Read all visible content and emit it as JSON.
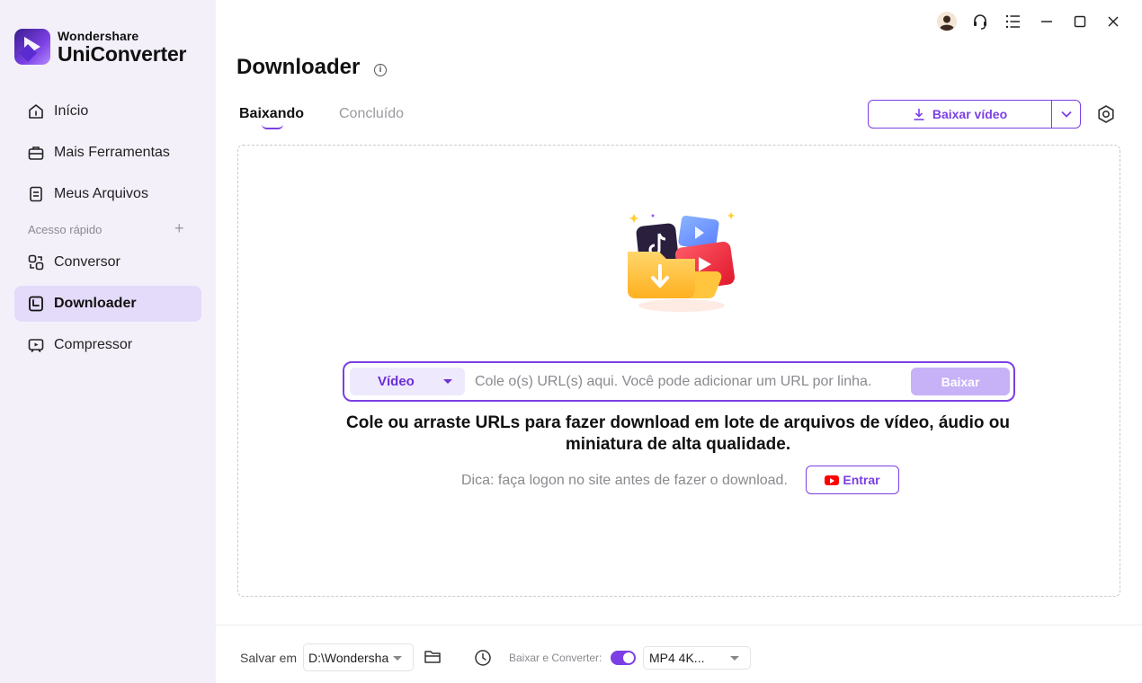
{
  "app": {
    "brand_sub": "Wondershare",
    "brand_main": "UniConverter",
    "accent_color": "#7b3fe4"
  },
  "sidebar": {
    "items": [
      {
        "label": "Início",
        "icon": "home-icon"
      },
      {
        "label": "Mais Ferramentas",
        "icon": "toolbox-icon"
      },
      {
        "label": "Meus Arquivos",
        "icon": "file-icon"
      }
    ],
    "quick_access_label": "Acesso rápido",
    "quick_items": [
      {
        "label": "Conversor",
        "icon": "converter-icon"
      },
      {
        "label": "Downloader",
        "icon": "downloader-icon",
        "active": true
      },
      {
        "label": "Compressor",
        "icon": "compressor-icon"
      }
    ]
  },
  "header": {
    "title": "Downloader",
    "tabs": [
      {
        "label": "Baixando",
        "active": true
      },
      {
        "label": "Concluído",
        "active": false
      }
    ],
    "download_button_label": "Baixar vídeo"
  },
  "main": {
    "url_type": "Vídeo",
    "url_placeholder": "Cole o(s) URL(s) aqui. Você pode adicionar um URL por linha.",
    "url_button": "Baixar",
    "hint_line1": "Cole ou arraste URLs para fazer download em lote de arquivos de vídeo, áudio ou",
    "hint_line2": "miniatura de alta qualidade.",
    "tip": "Dica: faça logon no site antes de fazer o download.",
    "login_button": "Entrar"
  },
  "footer": {
    "save_label": "Salvar em",
    "save_path": "D:\\Wondersha",
    "convert_label": "Baixar e Converter:",
    "convert_enabled": true,
    "format": "MP4 4K..."
  }
}
